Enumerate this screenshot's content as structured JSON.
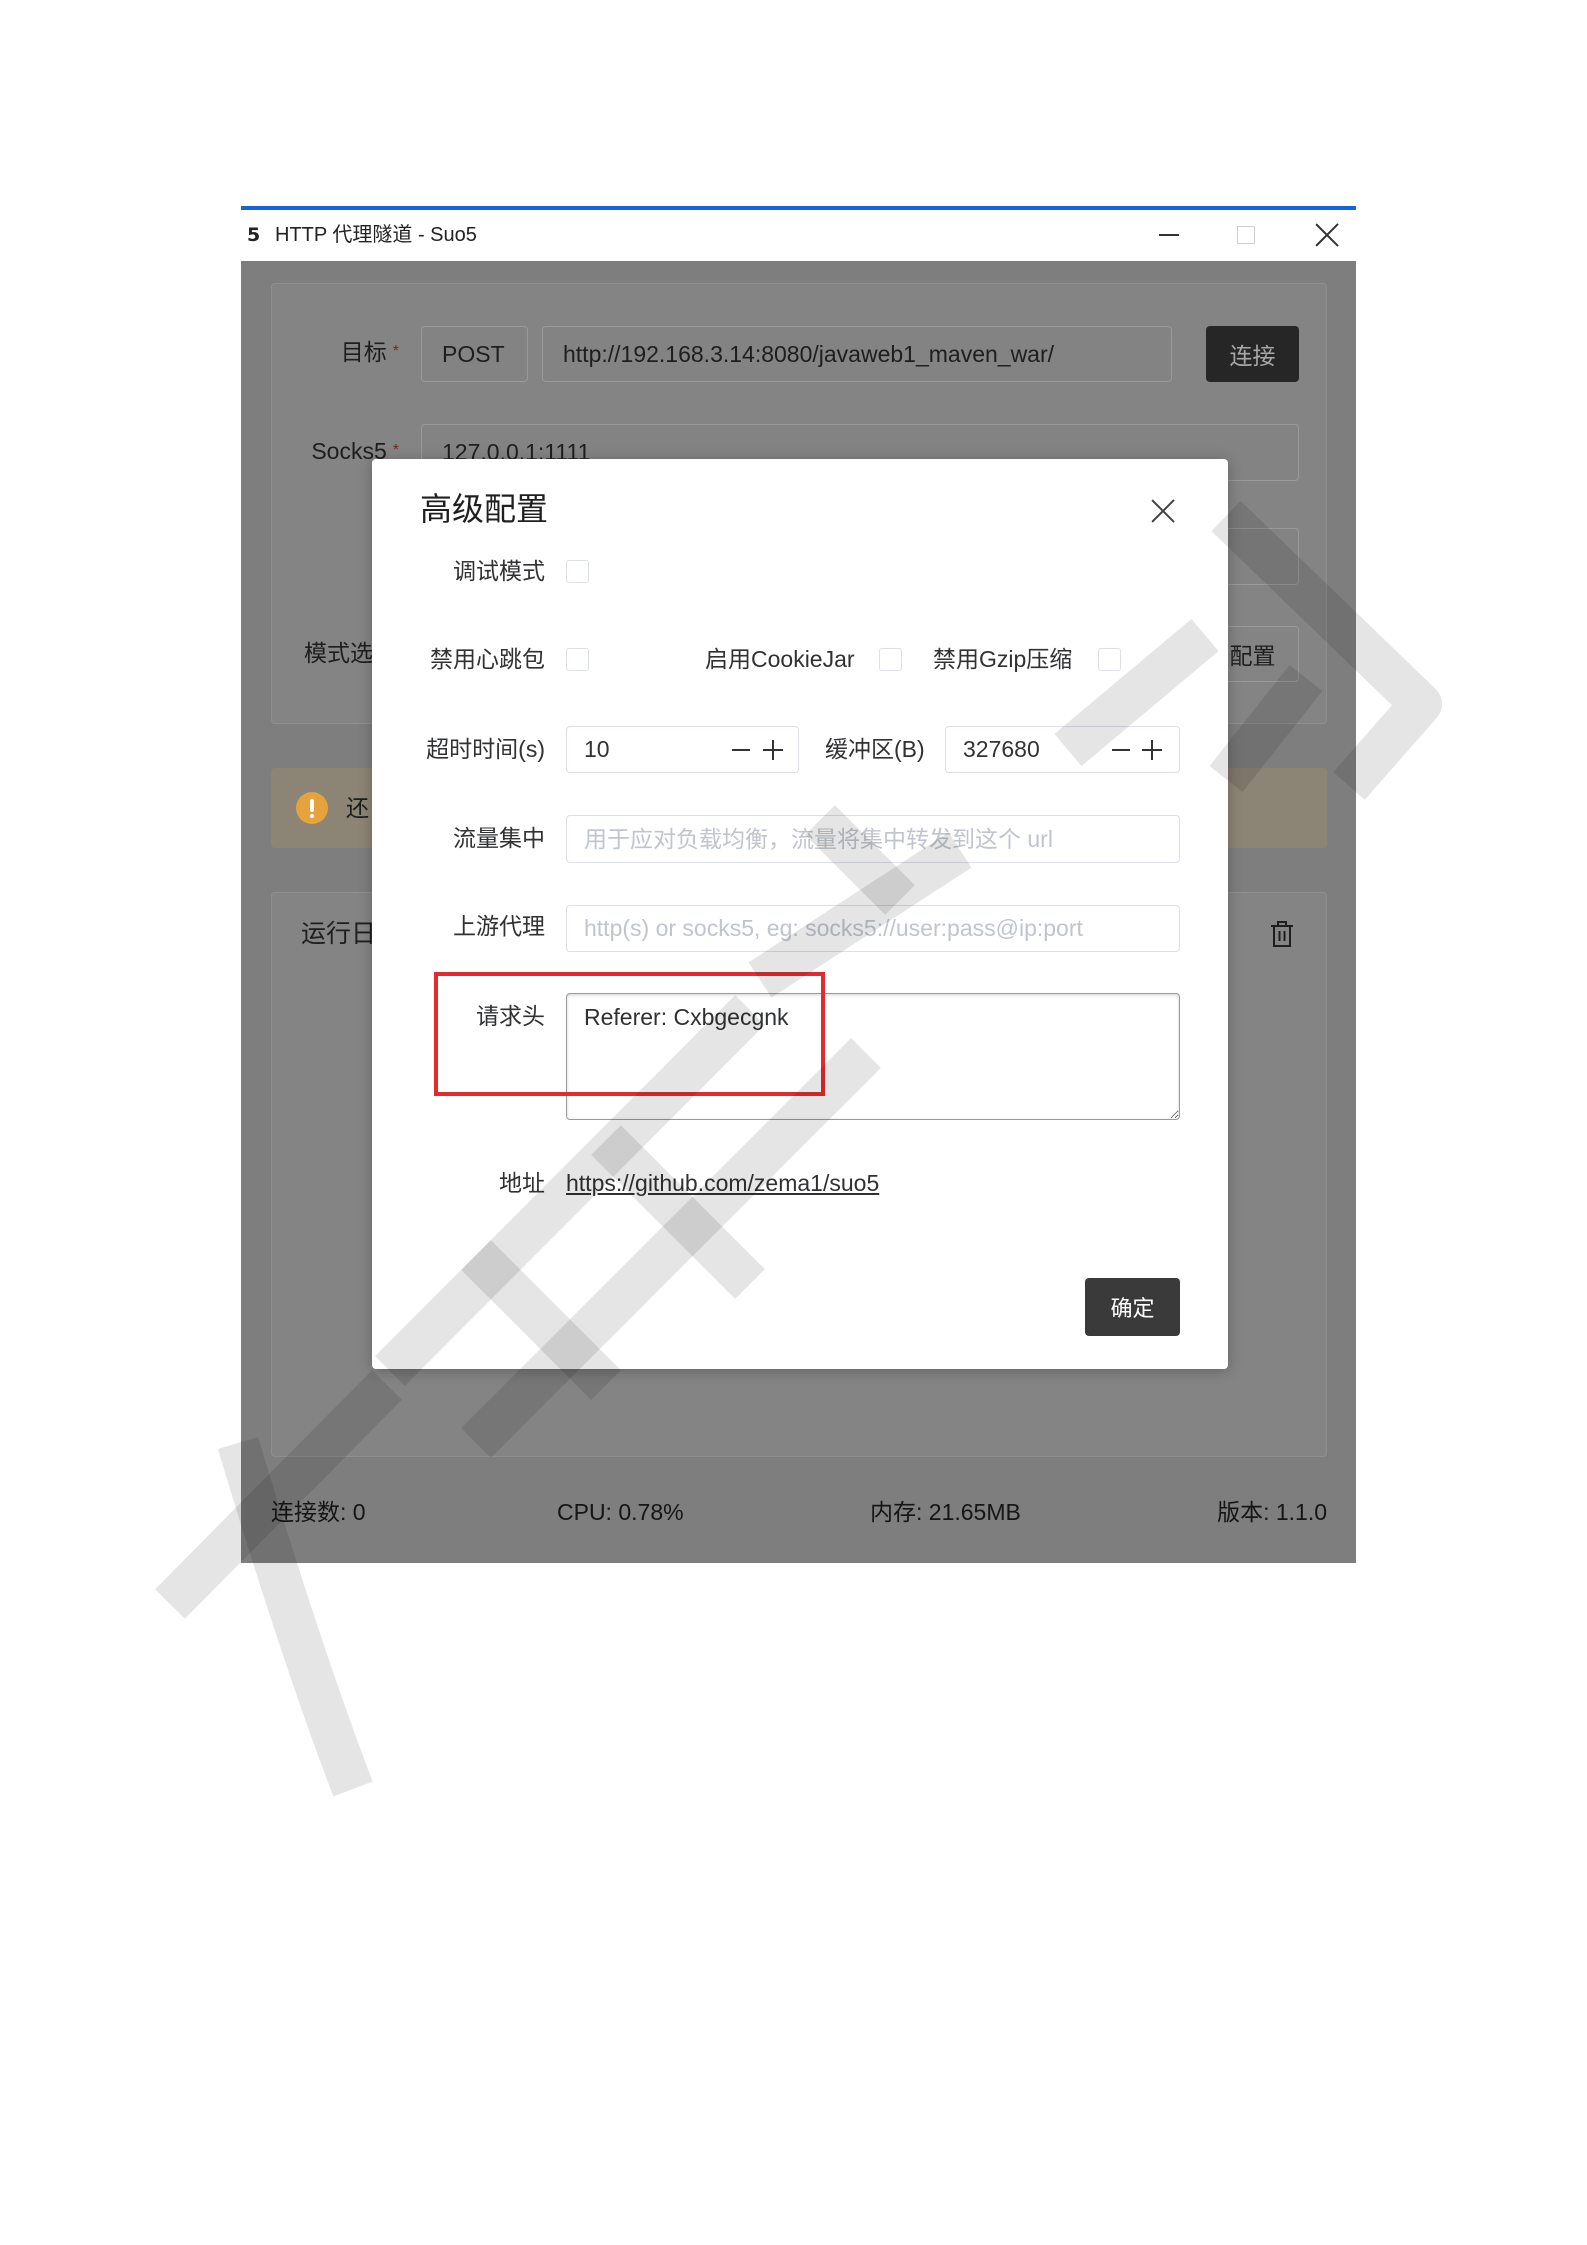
{
  "theme": {
    "accent": "#1565d8",
    "highlight": "#e32b2f",
    "warning": "#e6a23c",
    "primary_button": "#3a3a3a"
  },
  "window": {
    "app_icon": "5",
    "title": "HTTP 代理隧道 - Suo5",
    "controls": [
      "minimize-icon",
      "maximize-icon",
      "close-icon"
    ]
  },
  "form": {
    "target": {
      "label": "目标",
      "required_mark": "*",
      "method": "POST",
      "url": "http://192.168.3.14:8080/javaweb1_maven_war/"
    },
    "connect_label": "连接",
    "socks5": {
      "label": "Socks5",
      "required_mark": "*",
      "value": "127.0.0.1:1111"
    },
    "mode_label": "模式选",
    "config_label": "配置"
  },
  "alert": {
    "icon": "warning-icon",
    "text": "还"
  },
  "log": {
    "title": "运行日",
    "clear_icon": "trash-icon"
  },
  "status": {
    "connections": "连接数: 0",
    "cpu": "CPU: 0.78%",
    "memory": "内存: 21.65MB",
    "version": "版本: 1.1.0"
  },
  "dialog": {
    "title": "高级配置",
    "close_icon": "close-icon",
    "debug": {
      "label": "调试模式",
      "checked": false
    },
    "disable_heartbeat": {
      "label": "禁用心跳包",
      "checked": false
    },
    "enable_cookiejar": {
      "label": "启用CookieJar",
      "checked": false
    },
    "disable_gzip": {
      "label": "禁用Gzip压缩",
      "checked": false
    },
    "timeout": {
      "label": "超时时间(s)",
      "value": "10",
      "decrement_icon": "minus-icon",
      "increment_icon": "plus-icon"
    },
    "buffer": {
      "label": "缓冲区(B)",
      "value": "327680",
      "decrement_icon": "minus-icon",
      "increment_icon": "plus-icon"
    },
    "traffic_concentration": {
      "label": "流量集中",
      "placeholder": "用于应对负载均衡，流量将集中转发到这个 url"
    },
    "upstream_proxy": {
      "label": "上游代理",
      "placeholder": "http(s) or socks5, eg: socks5://user:pass@ip:port"
    },
    "headers": {
      "label": "请求头",
      "value": "Referer: Cxbgecgnk"
    },
    "address": {
      "label": "地址",
      "link": "https://github.com/zema1/suo5"
    },
    "ok_label": "确定"
  }
}
